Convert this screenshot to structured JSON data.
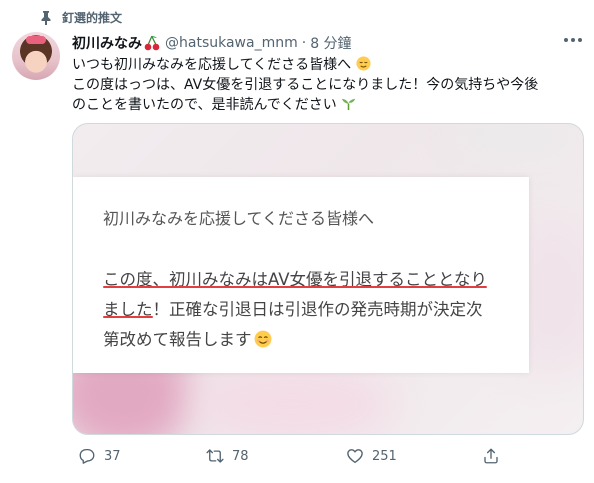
{
  "pinned": {
    "label": "釘選的推文",
    "icon": "pin-icon"
  },
  "tweet": {
    "author": {
      "display_name": "初川みなみ",
      "name_emoji": "cherry-icon",
      "handle": "@hatsukawa_mnm",
      "separator": "·",
      "time": "8 分鐘"
    },
    "text_lines": [
      "いつも初川みなみを応援してくださる皆様へ",
      "この度はっつは、AV女優を引退することになりました！今の気持ちや今後",
      "のことを書いたので、是非読んでください"
    ],
    "media": {
      "note_heading": "初川みなみを応援してくださる皆様へ",
      "note_row1_underlined": "この度、初川みなみはAV女優を引退することとなり",
      "note_row2_underlined": "ました",
      "note_row2_rest": "！正確な引退日は引退作の発売時期が決定次",
      "note_row3": "第改めて報告します"
    },
    "actions": {
      "reply_count": "37",
      "retweet_count": "78",
      "like_count": "251"
    }
  },
  "colors": {
    "text": "#0f1419",
    "secondary": "#536471",
    "underline": "#e2403f"
  }
}
